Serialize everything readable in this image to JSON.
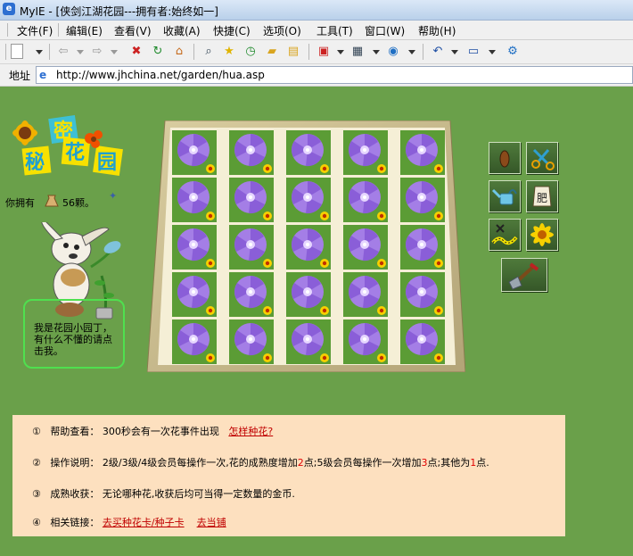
{
  "window": {
    "title": "MyIE - [侠剑江湖花园---拥有者:始终如一]"
  },
  "menu": [
    "文件(F)",
    "编辑(E)",
    "查看(V)",
    "收藏(A)",
    "快捷(C)",
    "选项(O)",
    "工具(T)",
    "窗口(W)",
    "帮助(H)"
  ],
  "address": {
    "label": "地址",
    "url": "http://www.jhchina.net/garden/hua.asp"
  },
  "logo": {
    "chars": [
      "秘",
      "密",
      "花",
      "园"
    ]
  },
  "inventory": {
    "prefix": "你拥有",
    "count": "56颗。"
  },
  "gardener": {
    "message": "我是花园小园丁，有什么不懂的请点击我。"
  },
  "garden": {
    "rows": 5,
    "cols": 5
  },
  "tools": [
    "seed",
    "scissors",
    "watering-can",
    "fertilizer",
    "insecticide",
    "sunflower",
    "shovel"
  ],
  "fertilizer_label": "肥",
  "info": {
    "row1": {
      "num": "①",
      "label": "帮助查看：",
      "text": "300秒会有一次花事件出现",
      "link": "怎样种花?"
    },
    "row2": {
      "num": "②",
      "label": "操作说明：",
      "a": "2级/3级/4级会员每操作一次,花的成熟度增加",
      "b": "2",
      "c": "点;5级会员每操作一次增加",
      "d": "3",
      "e": "点;其他为",
      "f": "1",
      "g": "点."
    },
    "row3": {
      "num": "③",
      "label": "成熟收获：",
      "text": "无论哪种花,收获后均可当得一定数量的金币."
    },
    "row4": {
      "num": "④",
      "label": "相关链接：",
      "link1": "去买种花卡/种子卡",
      "link2": "去当铺"
    }
  }
}
